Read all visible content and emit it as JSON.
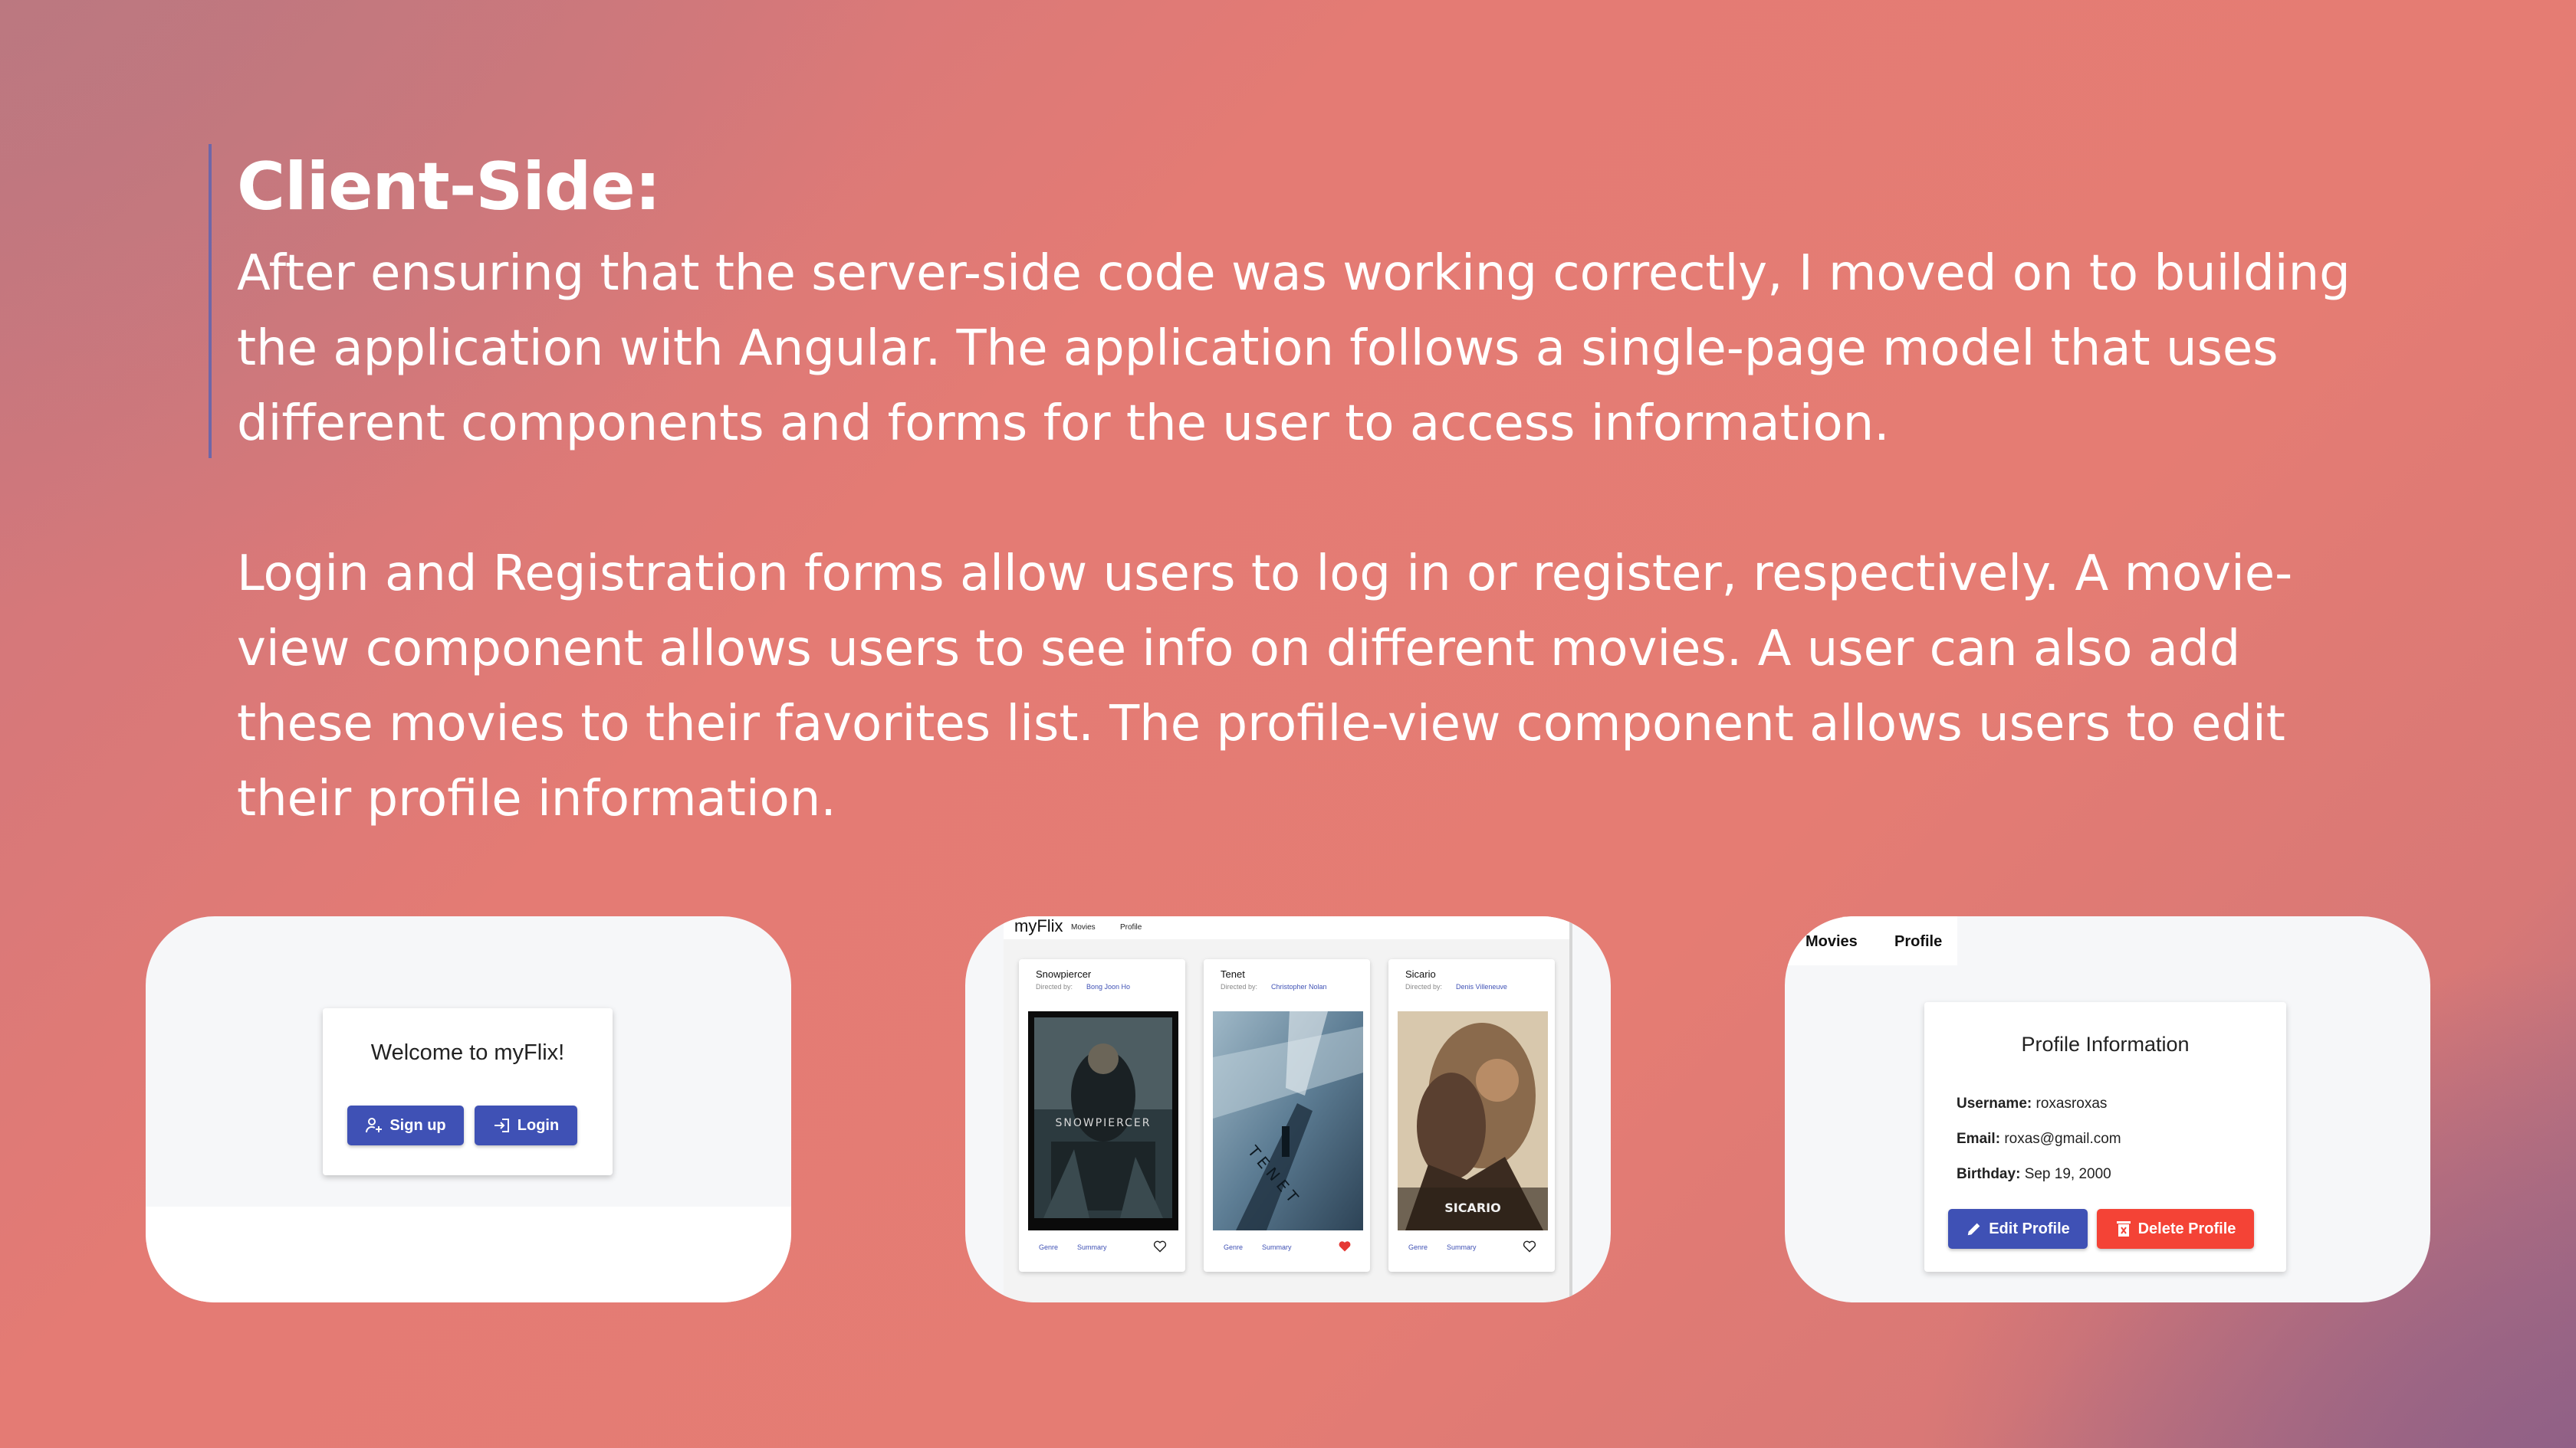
{
  "slide": {
    "heading": "Client-Side:",
    "paragraph1": "After ensuring that the server-side code was working correctly, I moved on to building the application with Angular. The application follows a single-page model that uses different components and forms for the user to access information.",
    "paragraph2": "Login and Registration forms allow users to log in or register, respectively. A movie-view component allows users to see info on different movies.  A user can also add these movies to their favorites list. The profile-view component allows users to edit their profile information."
  },
  "welcome_screen": {
    "title": "Welcome to myFlix!",
    "signup_label": "Sign up",
    "login_label": "Login",
    "signup_icon": "person-add-icon",
    "login_icon": "login-icon"
  },
  "movies_screen": {
    "brand": "myFlix",
    "nav": [
      "Movies",
      "Profile"
    ],
    "directed_by_label": "Directed by:",
    "genre_label": "Genre",
    "summary_label": "Summary",
    "movies": [
      {
        "title": "Snowpiercer",
        "director": "Bong Joon Ho",
        "poster_text": "SNOWPIERCER",
        "favorite": false
      },
      {
        "title": "Tenet",
        "director": "Christopher Nolan",
        "poster_text": "TENET",
        "favorite": true
      },
      {
        "title": "Sicario",
        "director": "Denis Villeneuve",
        "poster_text": "SICARIO",
        "favorite": false
      }
    ]
  },
  "profile_screen": {
    "tabs": [
      "Movies",
      "Profile"
    ],
    "title": "Profile Information",
    "username_label": "Username:",
    "username": "roxasroxas",
    "email_label": "Email:",
    "email": "roxas@gmail.com",
    "birthday_label": "Birthday:",
    "birthday": "Sep 19, 2000",
    "edit_label": "Edit Profile",
    "delete_label": "Delete Profile"
  },
  "colors": {
    "primary": "#3f51b5",
    "warn": "#f44336",
    "favorite": "#e53935"
  }
}
